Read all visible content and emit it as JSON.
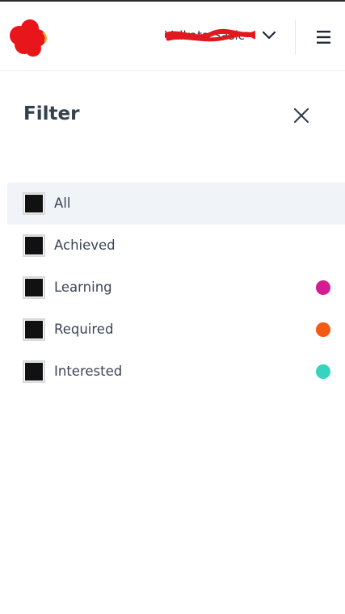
{
  "header": {
    "user_name": "Valkata Sasic",
    "colors": {
      "logo": "#e8151b",
      "logo_highlight": "#f5a623",
      "redaction": "#e0191e"
    }
  },
  "filter": {
    "title": "Filter",
    "items": [
      {
        "label": "All",
        "checked": true,
        "selected": true,
        "dot_color": null
      },
      {
        "label": "Achieved",
        "checked": true,
        "selected": false,
        "dot_color": null
      },
      {
        "label": "Learning",
        "checked": true,
        "selected": false,
        "dot_color": "#d41b94"
      },
      {
        "label": "Required",
        "checked": true,
        "selected": false,
        "dot_color": "#f55a12"
      },
      {
        "label": "Interested",
        "checked": true,
        "selected": false,
        "dot_color": "#35d4c0"
      }
    ]
  }
}
